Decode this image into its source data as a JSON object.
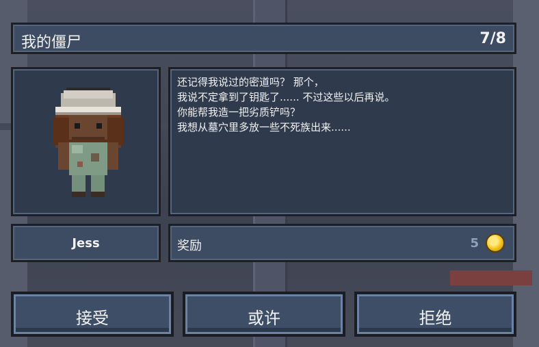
{
  "header": {
    "title": "我的僵尸",
    "count": "7/8"
  },
  "dialog": {
    "lines": [
      "还记得我说过的密道吗？ 那个，",
      "我说不定拿到了钥匙了...... 不过这些以后再说。",
      "你能帮我造一把劣质铲吗？",
      "我想从墓穴里多放一些不死族出来......"
    ]
  },
  "character": {
    "name": "Jess",
    "portrait_icon": "zombie-portrait"
  },
  "reward": {
    "label": "奖励",
    "value": "5",
    "icon": "gold-coin-icon"
  },
  "buttons": {
    "accept": "接受",
    "maybe": "或许",
    "refuse": "拒绝"
  },
  "colors": {
    "panel": "#3d4c62",
    "border": "#1c1f26",
    "coin": "#f4c21b"
  }
}
